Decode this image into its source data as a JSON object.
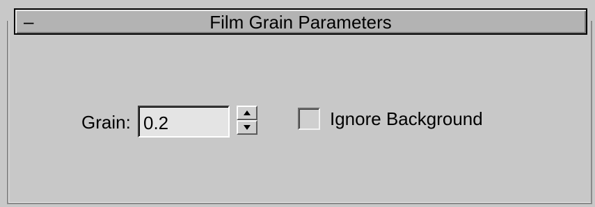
{
  "rollout": {
    "collapse_symbol": "–",
    "title": "Film Grain Parameters",
    "expanded": true
  },
  "grain": {
    "label": "Grain:",
    "value": "0.2",
    "spinner_icon": "up-down-spinner"
  },
  "ignore_background": {
    "label": "Ignore Background",
    "checked": false
  }
}
